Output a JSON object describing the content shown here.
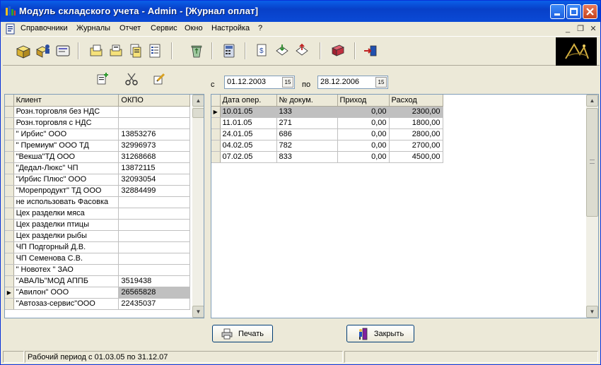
{
  "window": {
    "title": "Модуль складского учета - Admin - [Журнал оплат]"
  },
  "menu": [
    "Справочники",
    "Журналы",
    "Отчет",
    "Сервис",
    "Окно",
    "Настройка",
    "?"
  ],
  "filter": {
    "from_label": "с",
    "from_date": "01.12.2003",
    "to_label": "по",
    "to_date": "28.12.2006",
    "cal_label": "15"
  },
  "clients": {
    "headers": [
      "Клиент",
      "ОКПО"
    ],
    "rows": [
      [
        "Розн.торговля без НДС",
        ""
      ],
      [
        "Розн.торговля с НДС",
        ""
      ],
      [
        "\" Ирбис\" ООО",
        "13853276"
      ],
      [
        "\" Премиум\"  ООО ТД",
        "32996973"
      ],
      [
        "\"Векша\"ТД  ООО",
        "31268668"
      ],
      [
        "\"Дедал-Люкс\" ЧП",
        "13872115"
      ],
      [
        "\"Ирбис Плюс\" ООО",
        "32093054"
      ],
      [
        "\"Морепродукт\" ТД ООО",
        "32884499"
      ],
      [
        "не использовать Фасовка",
        ""
      ],
      [
        "Цех разделки мяса",
        ""
      ],
      [
        "Цех разделки птицы",
        ""
      ],
      [
        "Цех разделки рыбы",
        ""
      ],
      [
        "ЧП Подгорный Д.В.",
        ""
      ],
      [
        "ЧП Семенова С.В.",
        ""
      ],
      [
        "\" Новотех \" ЗАО",
        ""
      ],
      [
        "\"АВАЛЬ\"МОД АППБ",
        "3519438"
      ],
      [
        "\"Авилон\" ООО",
        "26565828"
      ],
      [
        "\"Автозаз-сервис\"ООО",
        "22435037"
      ]
    ],
    "selected": 16
  },
  "payments": {
    "headers": [
      "Дата опер.",
      "№ докум.",
      "Приход",
      "Расход"
    ],
    "rows": [
      [
        "10.01.05",
        "133",
        "0,00",
        "2300,00"
      ],
      [
        "11.01.05",
        "271",
        "0,00",
        "1800,00"
      ],
      [
        "24.01.05",
        "686",
        "0,00",
        "2800,00"
      ],
      [
        "04.02.05",
        "782",
        "0,00",
        "2700,00"
      ],
      [
        "07.02.05",
        "833",
        "0,00",
        "4500,00"
      ]
    ],
    "selected": 0
  },
  "buttons": {
    "print": "Печать",
    "close": "Закрыть"
  },
  "status": {
    "period": "Рабочий период с 01.03.05 по 31.12.07"
  },
  "colors": {
    "titlebar": "#0a4ad6",
    "selection": "#c0c0c0"
  }
}
